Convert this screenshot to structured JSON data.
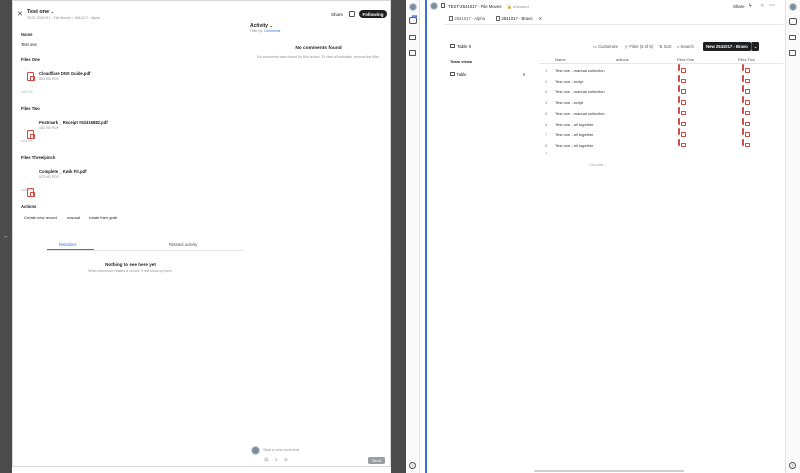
{
  "modal": {
    "title": "Test one",
    "breadcrumb": "TEST-2541017 - File Moves  >  2541017 - Alpha",
    "share_label": "Share",
    "following_label": "Following",
    "name_label": "Name",
    "name_value": "Test one",
    "files": [
      {
        "label": "Files One",
        "file_name": "Cloudflare DNS Guide.pdf",
        "file_meta": "553 KB PDF",
        "add_label": "Add file"
      },
      {
        "label": "Files Two",
        "file_name": "Postmark _ Receipt #62416882.pdf",
        "file_meta": "183 KB PDF",
        "add_label": "Add file"
      },
      {
        "label": "Files Three/pinch",
        "file_name": "Complete _ Kwik Fit.pdf",
        "file_meta": "572 KB PDF",
        "add_label": "Add file"
      }
    ],
    "actions_label": "Actions",
    "actions": [
      "Create new record",
      "manual",
      "rotate then grab"
    ],
    "tabs": {
      "relations": "Relations",
      "related_activity": "Related activity"
    },
    "empty_title": "Nothing to see here yet",
    "empty_sub": "When someone relates a record, it will show up here.",
    "activity": {
      "title": "Activity",
      "filter_prefix": "Filter by:",
      "filter_value": "Comments",
      "no_comments_title": "No comments found",
      "no_comments_sub": "No comments were found for this record. To view all activities, remove the filter."
    },
    "comment_placeholder": "Start a new comment",
    "send_label": "Send"
  },
  "right": {
    "breadcrumb": "TEST-2541017 - File Moves",
    "unlocked_label": "Unlocked",
    "share_label": "Share",
    "tabs": [
      "2541017 - Alpha",
      "2541017 - Bravo"
    ],
    "table_title": "Table 0",
    "toolbar": {
      "customize": "Customize",
      "filter": "Filter (5 of 8)",
      "sort": "Sort",
      "search": "Search",
      "new_record": "New 2541017 - Bravo"
    },
    "team_views_label": "Team views",
    "views": [
      {
        "name": "Table",
        "count": "8"
      }
    ],
    "columns": [
      "Name",
      "actions",
      "Files One",
      "Files Two"
    ],
    "rows": [
      {
        "num": "1",
        "name": "Test one - manual collection"
      },
      {
        "num": "2",
        "name": "Test one - script"
      },
      {
        "num": "3",
        "name": "Test one - manual collection"
      },
      {
        "num": "4",
        "name": "Test one - script"
      },
      {
        "num": "5",
        "name": "Test one - manual collection"
      },
      {
        "num": "6",
        "name": "Test one - all together"
      },
      {
        "num": "7",
        "name": "Test one - all together"
      },
      {
        "num": "8",
        "name": "Test one - all together"
      }
    ],
    "add_row_label": "+",
    "calculate_label": "Calculate"
  },
  "notification_count": "37",
  "accent": "#3b6fd8",
  "pdf_color": "#d24b45"
}
